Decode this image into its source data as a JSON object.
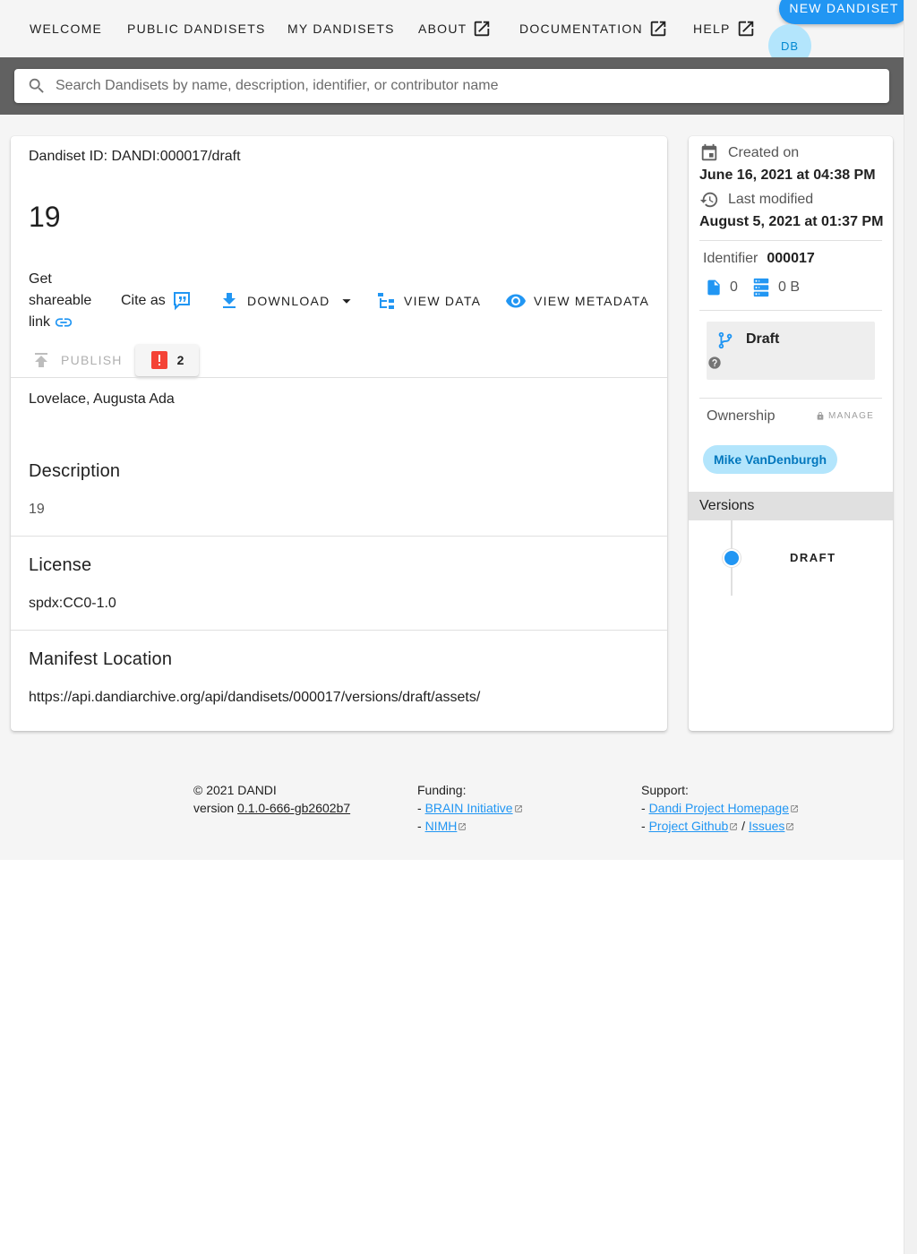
{
  "nav": {
    "items": [
      {
        "label": "Welcome"
      },
      {
        "label": "Public Dandisets"
      },
      {
        "label": "My Dandisets"
      },
      {
        "label": "About"
      },
      {
        "label": "Documentation"
      },
      {
        "label": "Help"
      }
    ],
    "new_button": "New Dandiset",
    "avatar_initials": "DB"
  },
  "search": {
    "placeholder": "Search Dandisets by name, description, identifier, or contributor name",
    "value": ""
  },
  "dandiset": {
    "id_line": "Dandiset ID: DANDI:000017/draft",
    "title": "19",
    "share_label": "Get shareable link",
    "cite_label": "Cite as",
    "download_label": "Download",
    "view_data_label": "View Data",
    "view_metadata_label": "View Metadata",
    "publish_label": "Publish",
    "error_count": "2",
    "contributors": "Lovelace, Augusta Ada",
    "description_title": "Description",
    "description": "19",
    "license_title": "License",
    "license": "spdx:CC0-1.0",
    "manifest_title": "Manifest Location",
    "manifest_url": "https://api.dandiarchive.org/api/dandisets/000017/versions/draft/assets/"
  },
  "side": {
    "created_label": "Created on",
    "created_value": "June 16, 2021 at 04:38 PM",
    "modified_label": "Last modified",
    "modified_value": "August 5, 2021 at 01:37 PM",
    "identifier_label": "Identifier",
    "identifier_value": "000017",
    "file_count": "0",
    "size": "0 B",
    "status": "Draft",
    "ownership_label": "Ownership",
    "manage_label": "Manage",
    "owner": "Mike VanDenburgh",
    "versions_label": "Versions",
    "version_item": "Draft"
  },
  "footer": {
    "copyright": "© 2021 DANDI",
    "version_prefix": "version",
    "version": "0.1.0-666-gb2602b7",
    "funding_label": "Funding:",
    "funding_links": [
      "BRAIN Initiative",
      "NIMH"
    ],
    "support_label": "Support:",
    "support_links": [
      "Dandi Project Homepage",
      "Project Github",
      "Issues"
    ],
    "separator": "/",
    "dash": "-"
  },
  "colors": {
    "accent": "#2196f3",
    "error": "#f44336",
    "search_band": "#616161",
    "chip": "#b3e5fc"
  },
  "icons": [
    "open-in-new-icon",
    "search-icon",
    "link-icon",
    "format-quote-icon",
    "download-icon",
    "file-tree-icon",
    "eye-icon",
    "upload-icon",
    "alert-box-icon",
    "calendar-icon",
    "history-icon",
    "file-icon",
    "server-icon",
    "source-branch-icon",
    "help-circle-icon",
    "lock-icon"
  ]
}
